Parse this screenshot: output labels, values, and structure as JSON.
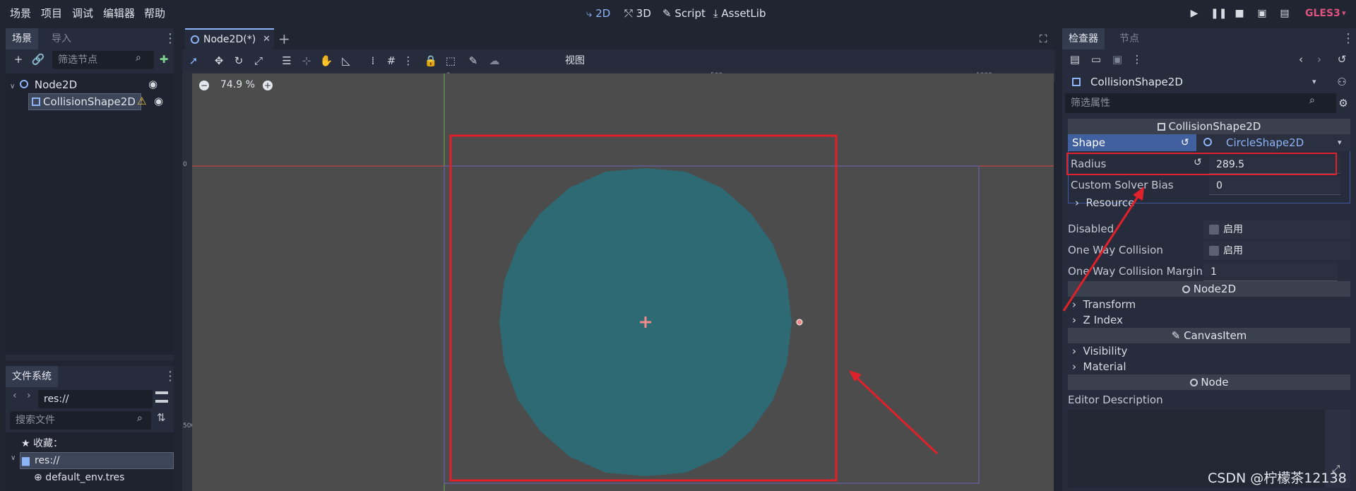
{
  "menu": {
    "items": [
      "场景",
      "项目",
      "调试",
      "编辑器",
      "帮助"
    ],
    "modes": [
      {
        "label": "2D",
        "icon": "2d-icon",
        "active": true
      },
      {
        "label": "3D",
        "icon": "3d-icon",
        "active": false
      },
      {
        "label": "Script",
        "icon": "script-icon",
        "active": false
      },
      {
        "label": "AssetLib",
        "icon": "download-icon",
        "active": false
      }
    ],
    "renderer": "GLES3"
  },
  "scene_dock": {
    "tabs": [
      "场景",
      "导入"
    ],
    "filter_placeholder": "筛选节点",
    "nodes": [
      {
        "label": "Node2D",
        "icon": "node2d-icon"
      },
      {
        "label": "CollisionShape2D",
        "icon": "collision-shape-icon",
        "warning": true
      }
    ]
  },
  "filesystem_dock": {
    "title": "文件系统",
    "path": "res://",
    "search_placeholder": "搜索文件",
    "favorites_label": "收藏：",
    "root_label": "res://",
    "files": [
      "default_env.tres"
    ]
  },
  "editor": {
    "scene_tab": "Node2D(*)",
    "view_menu": "视图",
    "zoom": "74.9 %",
    "ruler_labels": {
      "top": [
        "0",
        "500",
        "1000"
      ],
      "left": [
        "0",
        "500"
      ]
    }
  },
  "inspector": {
    "tabs": [
      "检查器",
      "节点"
    ],
    "object_name": "CollisionShape2D",
    "filter_placeholder": "筛选属性",
    "section_collision": "CollisionShape2D",
    "shape_label": "Shape",
    "shape_value": "CircleShape2D",
    "radius_label": "Radius",
    "radius_value": "289.5",
    "solver_bias_label": "Custom Solver Bias",
    "solver_bias_value": "0",
    "resource_label": "Resource",
    "disabled_label": "Disabled",
    "disabled_value": "启用",
    "one_way_label": "One Way Collision",
    "one_way_value": "启用",
    "one_way_margin_label": "One Way Collision Margin",
    "one_way_margin_value": "1",
    "section_node2d": "Node2D",
    "transform_label": "Transform",
    "zindex_label": "Z Index",
    "section_canvas": "CanvasItem",
    "visibility_label": "Visibility",
    "material_label": "Material",
    "section_node": "Node",
    "editor_description_label": "Editor Description"
  },
  "watermark": "CSDN @柠檬茶12138",
  "colors": {
    "accent": "#8db4f7",
    "shape_fill": "#2e6a74",
    "annotation_red": "#e0202a",
    "renderer": "#e0537f"
  }
}
